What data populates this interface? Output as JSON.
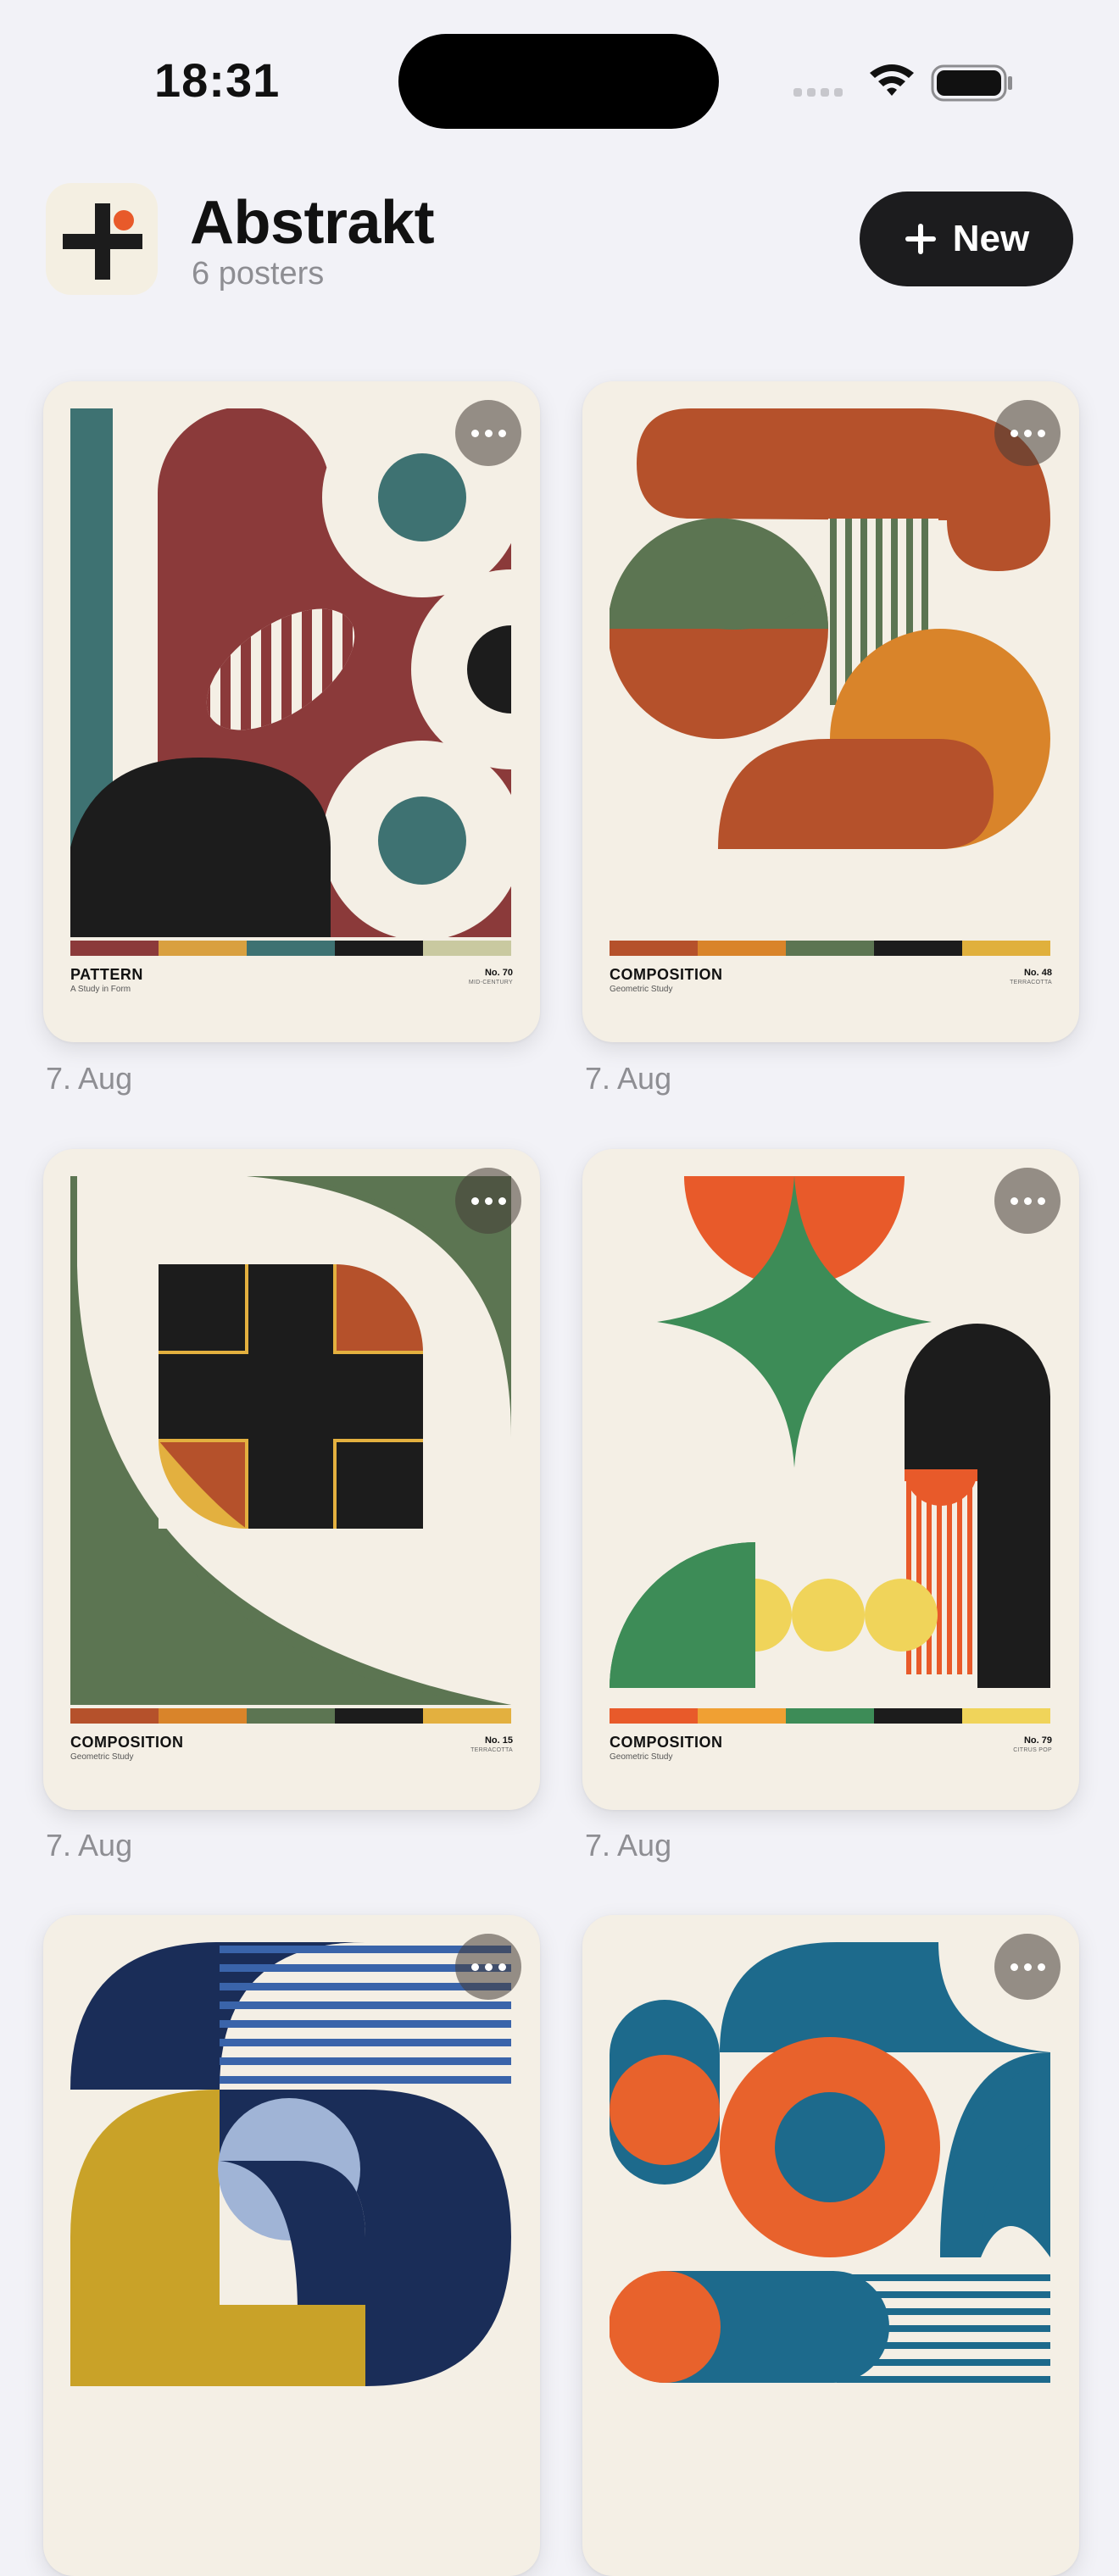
{
  "status": {
    "time": "18:31"
  },
  "header": {
    "title": "Abstrakt",
    "subtitle": "6 posters",
    "new_label": "New"
  },
  "posters": [
    {
      "title": "PATTERN",
      "subtitle": "A Study in Form",
      "number": "No. 70",
      "series": "MID-CENTURY",
      "date": "7. Aug",
      "palette": [
        "#8b3a3a",
        "#d9a03f",
        "#3e7272",
        "#1c1c1c",
        "#c9c9a0"
      ]
    },
    {
      "title": "COMPOSITION",
      "subtitle": "Geometric Study",
      "number": "No. 48",
      "series": "TERRACOTTA",
      "date": "7. Aug",
      "palette": [
        "#b5512b",
        "#d9842a",
        "#5c7552",
        "#1c1c1c",
        "#e0b03c"
      ]
    },
    {
      "title": "COMPOSITION",
      "subtitle": "Geometric Study",
      "number": "No. 15",
      "series": "TERRACOTTA",
      "date": "7. Aug",
      "palette": [
        "#b5512b",
        "#d9842a",
        "#5c7552",
        "#1c1c1c",
        "#e3b03f"
      ]
    },
    {
      "title": "COMPOSITION",
      "subtitle": "Geometric Study",
      "number": "No. 79",
      "series": "CITRUS POP",
      "date": "7. Aug",
      "palette": [
        "#e85a2a",
        "#f0a033",
        "#3d8c57",
        "#1c1c1c",
        "#f0d45a"
      ]
    },
    {
      "title": "",
      "subtitle": "",
      "number": "",
      "series": "",
      "date": "",
      "palette": [
        "#1a2d58",
        "#3a64aa",
        "#c9a228",
        "#a0b4d6",
        "#f4efe5"
      ]
    },
    {
      "title": "",
      "subtitle": "",
      "number": "",
      "series": "",
      "date": "",
      "palette": [
        "#1d6a8c",
        "#e8622c",
        "#f4efe5",
        "#1d6a8c",
        "#e8622c"
      ]
    }
  ]
}
